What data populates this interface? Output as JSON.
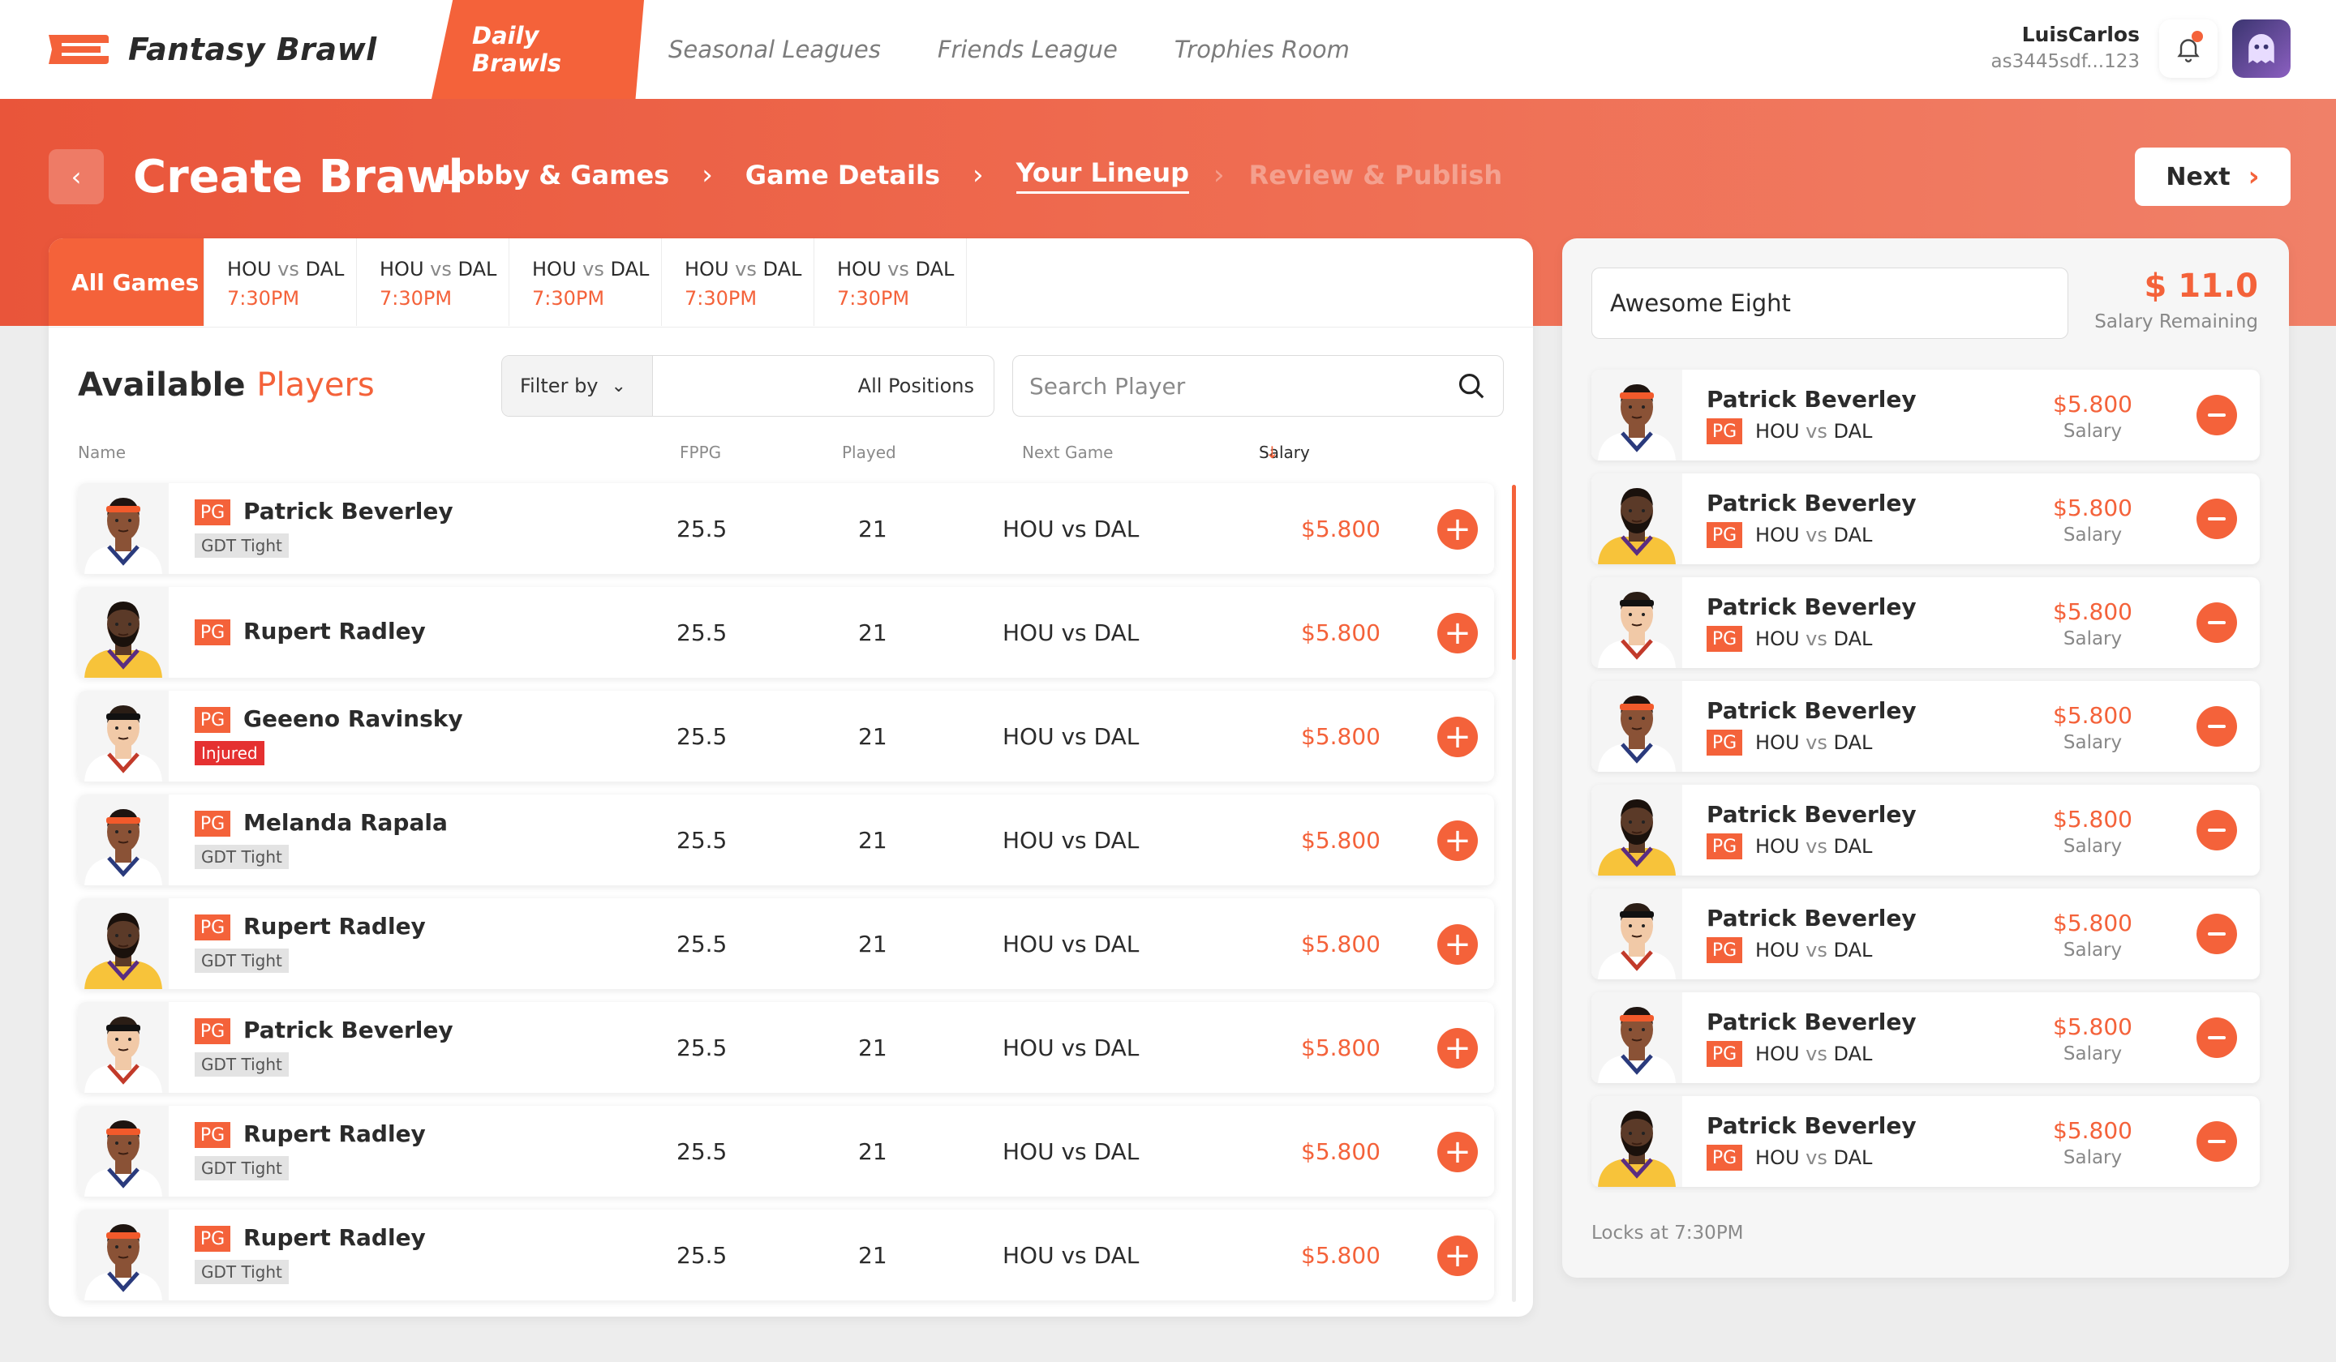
{
  "app": {
    "name": "Fantasy Brawl",
    "accent": "#f4623a"
  },
  "nav": {
    "tabs": [
      {
        "label": "Daily Brawls",
        "active": true
      },
      {
        "label": "Seasonal Leagues",
        "active": false
      },
      {
        "label": "Friends League",
        "active": false
      },
      {
        "label": "Trophies Room",
        "active": false
      }
    ]
  },
  "user": {
    "name": "LuisCarlos",
    "id": "as3445sdf...123",
    "has_notification": true
  },
  "header": {
    "title": "Create Brawl",
    "back_icon": "chevron-left-icon",
    "steps": [
      {
        "label": "Lobby & Games",
        "state": "done"
      },
      {
        "label": "Game Details",
        "state": "done"
      },
      {
        "label": "Your Lineup",
        "state": "current"
      },
      {
        "label": "Review & Publish",
        "state": "future"
      }
    ],
    "next_label": "Next"
  },
  "games": {
    "all_label": "All Games",
    "items": [
      {
        "home": "HOU",
        "vs": "vs",
        "away": "DAL",
        "time": "7:30PM"
      },
      {
        "home": "HOU",
        "vs": "vs",
        "away": "DAL",
        "time": "7:30PM"
      },
      {
        "home": "HOU",
        "vs": "vs",
        "away": "DAL",
        "time": "7:30PM"
      },
      {
        "home": "HOU",
        "vs": "vs",
        "away": "DAL",
        "time": "7:30PM"
      },
      {
        "home": "HOU",
        "vs": "vs",
        "away": "DAL",
        "time": "7:30PM"
      }
    ]
  },
  "players": {
    "title_a": "Available ",
    "title_b": "Players",
    "filter_label": "Filter by",
    "filter_value": "All Positions",
    "search_placeholder": "Search Player",
    "columns": {
      "name": "Name",
      "fppg": "FPPG",
      "played": "Played",
      "next_game": "Next Game",
      "salary": "Salary"
    },
    "rows": [
      {
        "pos": "PG",
        "name": "Patrick Beverley",
        "status": "GDT Tight",
        "status_type": "tight",
        "fppg": "25.5",
        "played": "21",
        "next_game": "HOU vs DAL",
        "salary": "$5.800",
        "face": "a"
      },
      {
        "pos": "PG",
        "name": "Rupert Radley",
        "status": "",
        "status_type": "none",
        "fppg": "25.5",
        "played": "21",
        "next_game": "HOU vs DAL",
        "salary": "$5.800",
        "face": "b"
      },
      {
        "pos": "PG",
        "name": "Geeeno Ravinsky",
        "status": "Injured",
        "status_type": "injured",
        "fppg": "25.5",
        "played": "21",
        "next_game": "HOU vs DAL",
        "salary": "$5.800",
        "face": "c"
      },
      {
        "pos": "PG",
        "name": "Melanda Rapala",
        "status": "GDT Tight",
        "status_type": "tight",
        "fppg": "25.5",
        "played": "21",
        "next_game": "HOU vs DAL",
        "salary": "$5.800",
        "face": "a"
      },
      {
        "pos": "PG",
        "name": "Rupert Radley",
        "status": "GDT Tight",
        "status_type": "tight",
        "fppg": "25.5",
        "played": "21",
        "next_game": "HOU vs DAL",
        "salary": "$5.800",
        "face": "b"
      },
      {
        "pos": "PG",
        "name": "Patrick Beverley",
        "status": "GDT Tight",
        "status_type": "tight",
        "fppg": "25.5",
        "played": "21",
        "next_game": "HOU vs DAL",
        "salary": "$5.800",
        "face": "c"
      },
      {
        "pos": "PG",
        "name": "Rupert Radley",
        "status": "GDT Tight",
        "status_type": "tight",
        "fppg": "25.5",
        "played": "21",
        "next_game": "HOU vs DAL",
        "salary": "$5.800",
        "face": "a"
      },
      {
        "pos": "PG",
        "name": "Rupert Radley",
        "status": "GDT Tight",
        "status_type": "tight",
        "fppg": "25.5",
        "played": "21",
        "next_game": "HOU vs DAL",
        "salary": "$5.800",
        "face": "a"
      }
    ]
  },
  "lineup": {
    "team_name": "Awesome Eight",
    "salary_remaining": "$ 11.0",
    "salary_remaining_label": "Salary Remaining",
    "salary_label": "Salary",
    "locks_text": "Locks at 7:30PM",
    "rows": [
      {
        "name": "Patrick Beverley",
        "pos": "PG",
        "home": "HOU",
        "vs": "vs",
        "away": "DAL",
        "salary": "$5.800",
        "face": "a"
      },
      {
        "name": "Patrick Beverley",
        "pos": "PG",
        "home": "HOU",
        "vs": "vs",
        "away": "DAL",
        "salary": "$5.800",
        "face": "b"
      },
      {
        "name": "Patrick Beverley",
        "pos": "PG",
        "home": "HOU",
        "vs": "vs",
        "away": "DAL",
        "salary": "$5.800",
        "face": "c"
      },
      {
        "name": "Patrick Beverley",
        "pos": "PG",
        "home": "HOU",
        "vs": "vs",
        "away": "DAL",
        "salary": "$5.800",
        "face": "a"
      },
      {
        "name": "Patrick Beverley",
        "pos": "PG",
        "home": "HOU",
        "vs": "vs",
        "away": "DAL",
        "salary": "$5.800",
        "face": "b"
      },
      {
        "name": "Patrick Beverley",
        "pos": "PG",
        "home": "HOU",
        "vs": "vs",
        "away": "DAL",
        "salary": "$5.800",
        "face": "c"
      },
      {
        "name": "Patrick Beverley",
        "pos": "PG",
        "home": "HOU",
        "vs": "vs",
        "away": "DAL",
        "salary": "$5.800",
        "face": "a"
      },
      {
        "name": "Patrick Beverley",
        "pos": "PG",
        "home": "HOU",
        "vs": "vs",
        "away": "DAL",
        "salary": "$5.800",
        "face": "b"
      }
    ]
  }
}
